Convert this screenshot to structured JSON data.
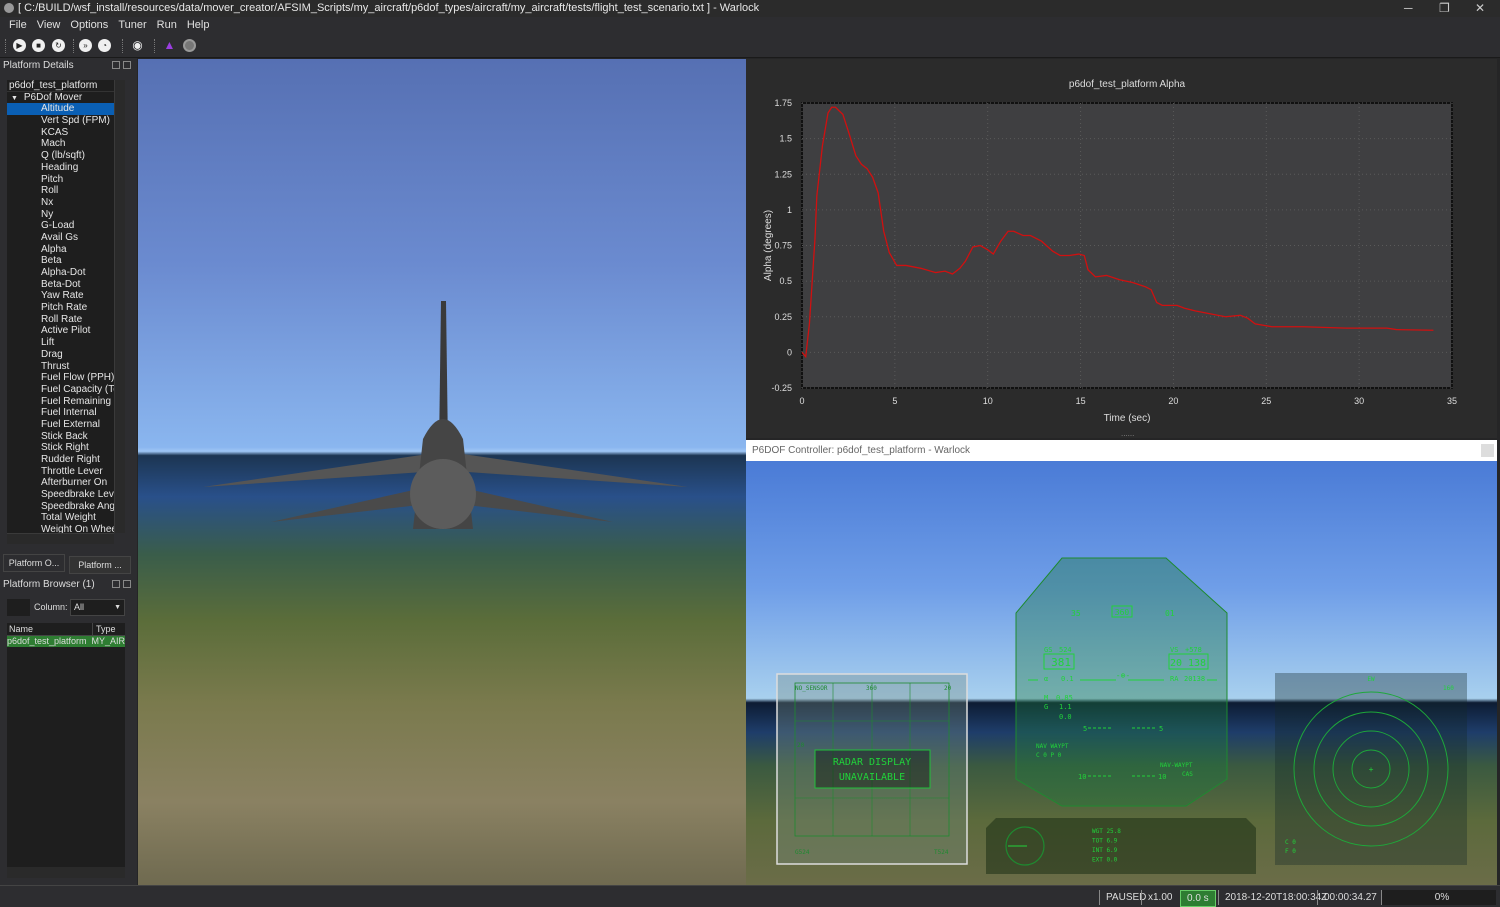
{
  "window": {
    "title": "[ C:/BUILD/wsf_install/resources/data/mover_creator/AFSIM_Scripts/my_aircraft/p6dof_types/aircraft/my_aircraft/tests/flight_test_scenario.txt ] - Warlock"
  },
  "menu": [
    "File",
    "View",
    "Options",
    "Tuner",
    "Run",
    "Help"
  ],
  "toolbar": {
    "icons": [
      "play-icon",
      "stop-icon",
      "reset-icon",
      "fast-forward-icon",
      "clock-icon",
      "eye-icon",
      "wizard-icon",
      "record-icon"
    ]
  },
  "platform_details": {
    "title": "Platform Details",
    "platform": "p6dof_test_platform",
    "group": "P6Dof Mover",
    "selected": "Altitude",
    "items": [
      "Altitude",
      "Vert Spd (FPM)",
      "KCAS",
      "Mach",
      "Q (lb/sqft)",
      "Heading",
      "Pitch",
      "Roll",
      "Nx",
      "Ny",
      "G-Load",
      "Avail Gs",
      "Alpha",
      "Beta",
      "Alpha-Dot",
      "Beta-Dot",
      "Yaw Rate",
      "Pitch Rate",
      "Roll Rate",
      "Active Pilot",
      "Lift",
      "Drag",
      "Thrust",
      "Fuel Flow (PPH)",
      "Fuel Capacity (Tot",
      "Fuel Remaining",
      "Fuel Internal",
      "Fuel External",
      "Stick Back",
      "Stick Right",
      "Rudder Right",
      "Throttle Lever",
      "Afterburner On",
      "Speedbrake Lever",
      "Speedbrake Angle",
      "Total Weight",
      "Weight On Wheels"
    ],
    "tabs": [
      "Platform O...",
      "Platform ..."
    ]
  },
  "platform_browser": {
    "title": "Platform Browser (1)",
    "column_label": "Column:",
    "column_value": "All",
    "headers": [
      "Name",
      "Type"
    ],
    "rows": [
      {
        "name": "p6dof_test_platform",
        "type": "MY_AIR"
      }
    ],
    "row_color": "#2e7d32"
  },
  "chart_data": {
    "type": "line",
    "title": "p6dof_test_platform Alpha",
    "xlabel": "Time (sec)",
    "ylabel": "Alpha (degrees)",
    "xlim": [
      0,
      35
    ],
    "ylim": [
      -0.25,
      1.75
    ],
    "xticks": [
      "0",
      "5",
      "10",
      "15",
      "20",
      "25",
      "30",
      "35"
    ],
    "yticks": [
      "-0.25",
      "0",
      "0.25",
      "0.5",
      "0.75",
      "1",
      "1.25",
      "1.5",
      "1.75"
    ],
    "grid": true,
    "line_color": "#d01010",
    "x": [
      0,
      0.2,
      0.4,
      0.7,
      0.8,
      1.1,
      1.4,
      1.6,
      1.8,
      2.2,
      2.5,
      2.9,
      3.2,
      3.5,
      3.8,
      4.1,
      4.4,
      4.7,
      5.1,
      5.6,
      6.4,
      7.2,
      7.7,
      8.1,
      8.5,
      8.8,
      9.2,
      9.6,
      10.0,
      10.3,
      10.7,
      11.1,
      11.4,
      11.9,
      12.3,
      12.9,
      13.5,
      13.9,
      14.4,
      14.9,
      15.2,
      15.4,
      15.8,
      16.4,
      17.1,
      17.8,
      18.5,
      18.8,
      19.1,
      19.4,
      20.2,
      20.6,
      21.2,
      22.0,
      22.8,
      23.6,
      24.0,
      24.4,
      25.3,
      27,
      29.3,
      31.5,
      32,
      34
    ],
    "y": [
      0,
      -0.03,
      0.2,
      0.8,
      1.1,
      1.45,
      1.68,
      1.72,
      1.72,
      1.67,
      1.55,
      1.38,
      1.32,
      1.29,
      1.23,
      1.12,
      0.85,
      0.7,
      0.61,
      0.61,
      0.59,
      0.56,
      0.57,
      0.55,
      0.59,
      0.64,
      0.74,
      0.75,
      0.72,
      0.69,
      0.78,
      0.85,
      0.85,
      0.82,
      0.82,
      0.78,
      0.71,
      0.68,
      0.68,
      0.69,
      0.68,
      0.58,
      0.53,
      0.54,
      0.51,
      0.49,
      0.46,
      0.44,
      0.35,
      0.33,
      0.33,
      0.31,
      0.29,
      0.27,
      0.25,
      0.26,
      0.24,
      0.2,
      0.18,
      0.18,
      0.17,
      0.17,
      0.16,
      0.155
    ]
  },
  "controller": {
    "title": "P6DOF Controller: p6dof_test_platform - Warlock",
    "hud": {
      "heading": "360",
      "hdg_left": "35",
      "hdg_right": "01",
      "gs_label": "GS",
      "gs": "524",
      "speed": "381",
      "vs_label": "VS",
      "vs": "+578",
      "altitude": "20 138",
      "alpha_label": "α",
      "alpha": "0.1",
      "ra_label": "RA",
      "ra": "20138",
      "mach_label": "M",
      "mach": "0.85",
      "g_label": "G",
      "g": "1.1",
      "g2": "0.0",
      "pitch5": "5",
      "pitch10": "10",
      "nav_waypt": "NAV WAYPT",
      "cop": "C  0 P  0",
      "nav_waypt2": "NAV-WAYPT",
      "cas": "CAS"
    },
    "radar": {
      "status_line1": "RADAR DISPLAY",
      "status_line2": "UNAVAILABLE",
      "sensor": "NO_SENSOR",
      "heading": "360",
      "range": "20",
      "range_marker": "20",
      "bottom_left": "G524",
      "bottom_right": "T524"
    },
    "fuel": {
      "rows": [
        "WGT 25.8",
        "TOT  6.9",
        "INT  6.9",
        "EXT  0.0"
      ]
    },
    "rwr": {
      "top": "EW",
      "right": "160",
      "c": "C   0",
      "f": "F   0"
    }
  },
  "status": {
    "state": "PAUSED",
    "rate": "x1.00",
    "sim_time": "0.0 s",
    "datetime": "2018-12-20T18:00:34Z",
    "elapsed": "00:00:34.27",
    "progress": "0%"
  }
}
